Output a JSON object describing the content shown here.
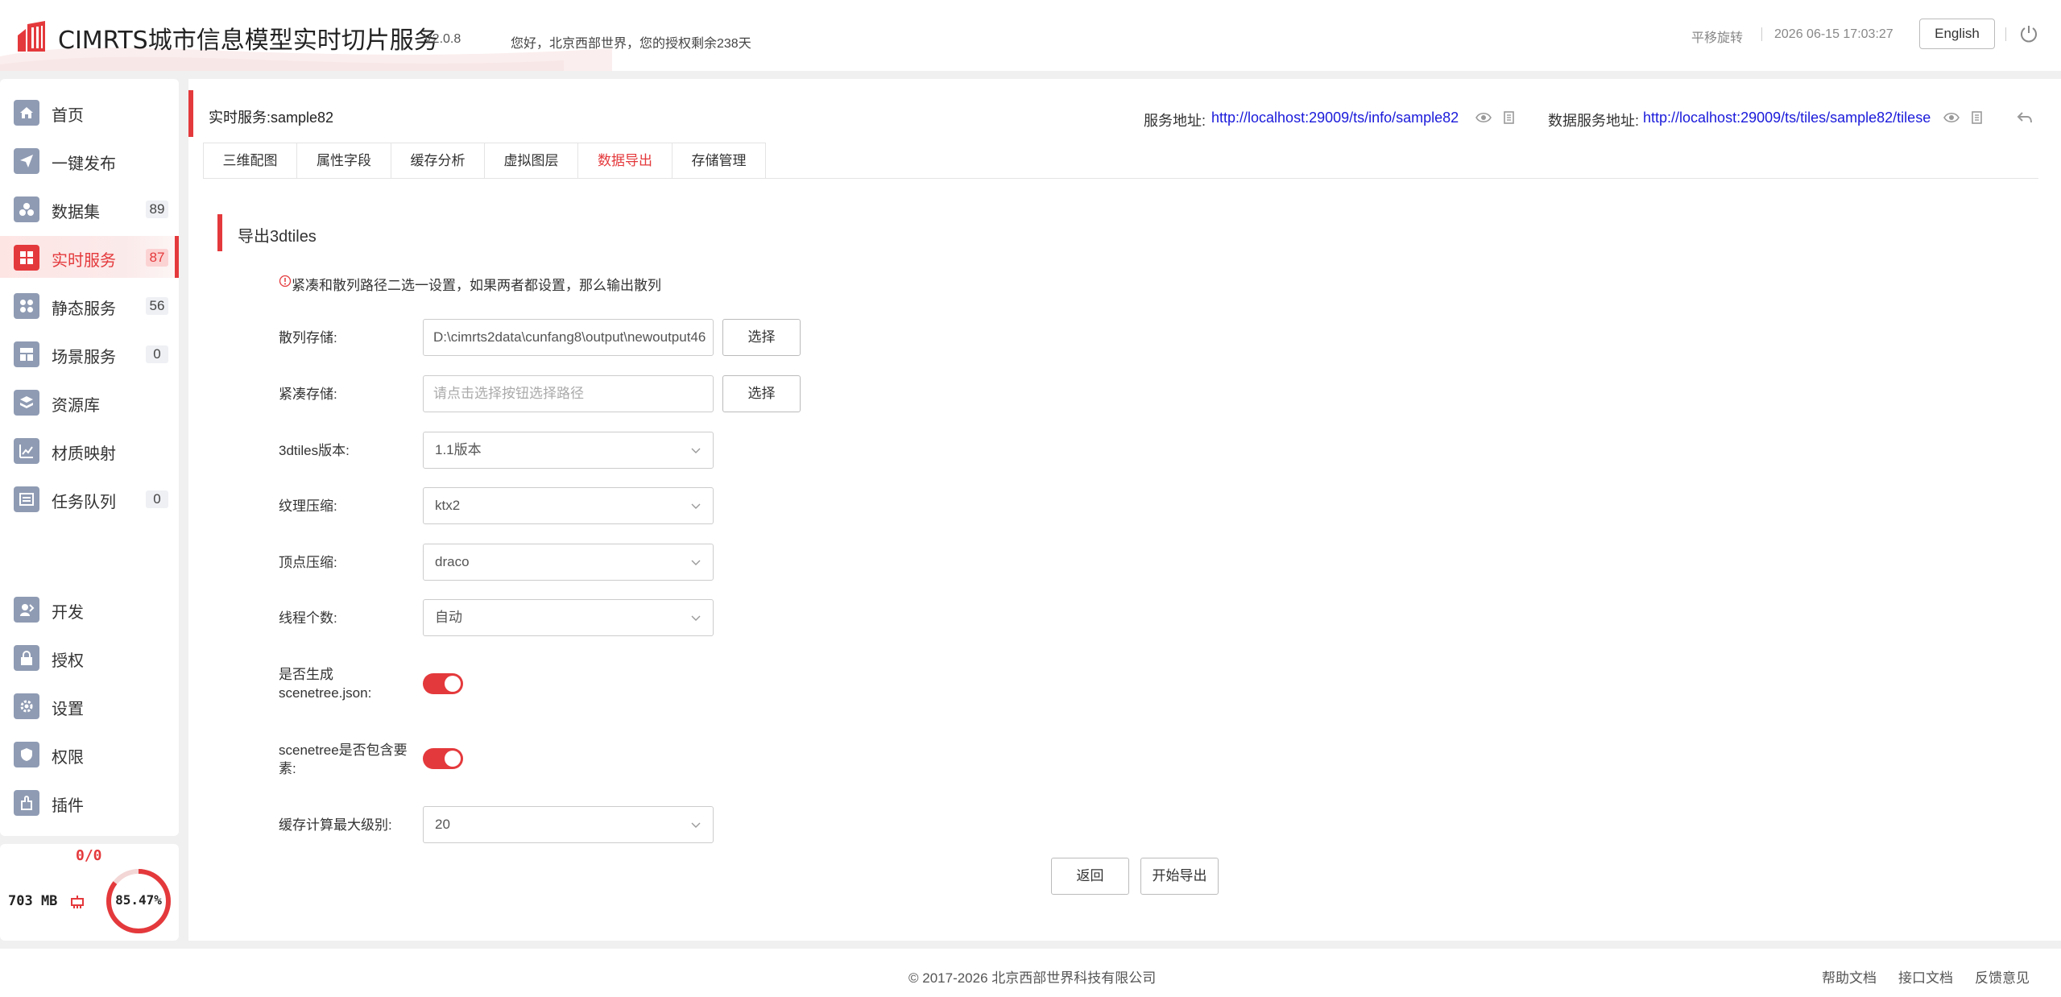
{
  "header": {
    "app_title": "CIMRTS城市信息模型实时切片服务",
    "version": "V2.0.8",
    "greeting": "您好，北京西部世界，您的授权剩余238天",
    "mode": "平移旋转",
    "datetime": "2026 06-15 17:03:27",
    "language_button": "English",
    "logo_icon": "building-logo-icon",
    "power_icon": "power-icon"
  },
  "sidebar": {
    "items": [
      {
        "label": "首页",
        "count": "",
        "icon": "home-icon"
      },
      {
        "label": "一键发布",
        "count": "",
        "icon": "paper-plane-icon"
      },
      {
        "label": "数据集",
        "count": "89",
        "icon": "dataset-icon"
      },
      {
        "label": "实时服务",
        "count": "87",
        "icon": "grid-icon",
        "active": true
      },
      {
        "label": "静态服务",
        "count": "56",
        "icon": "apps-icon"
      },
      {
        "label": "场景服务",
        "count": "0",
        "icon": "scene-icon"
      },
      {
        "label": "资源库",
        "count": "",
        "icon": "layers-icon"
      },
      {
        "label": "材质映射",
        "count": "",
        "icon": "chart-icon"
      },
      {
        "label": "任务队列",
        "count": "0",
        "icon": "queue-icon"
      }
    ],
    "bottom_items": [
      {
        "label": "开发",
        "icon": "developer-icon"
      },
      {
        "label": "授权",
        "icon": "lock-icon"
      },
      {
        "label": "设置",
        "icon": "gear-icon"
      },
      {
        "label": "权限",
        "icon": "shield-icon"
      },
      {
        "label": "插件",
        "icon": "plugin-icon"
      }
    ],
    "status": {
      "tasks": "0/0",
      "memory": "703 MB",
      "usage_text": "85.47%",
      "usage_value": 85.47,
      "accent": "#e4393c"
    }
  },
  "main": {
    "service_title": "实时服务:sample82",
    "service_addr_label": "服务地址:",
    "service_addr": "http://localhost:29009/ts/info/sample82",
    "data_addr_label": "数据服务地址:",
    "data_addr": "http://localhost:29009/ts/tiles/sample82/tilese",
    "tabs": [
      "三维配图",
      "属性字段",
      "缓存分析",
      "虚拟图层",
      "数据导出",
      "存储管理"
    ],
    "active_tab": 4,
    "section_title": "导出3dtiles",
    "tip": "紧凑和散列路径二选一设置，如果两者都设置，那么输出散列",
    "form": {
      "hash_store_label": "散列存储:",
      "hash_store_value": "D:\\cimrts2data\\cunfang8\\output\\newoutput46",
      "compact_store_label": "紧凑存储:",
      "compact_store_placeholder": "请点击选择按钮选择路径",
      "select_button": "选择",
      "version_label": "3dtiles版本:",
      "version_value": "1.1版本",
      "texture_label": "纹理压缩:",
      "texture_value": "ktx2",
      "vertex_label": "顶点压缩:",
      "vertex_value": "draco",
      "threads_label": "线程个数:",
      "threads_value": "自动",
      "scenetree_label": "是否生成scenetree.json:",
      "scenetree_on": true,
      "scenetree_elements_label": "scenetree是否包含要素:",
      "scenetree_elements_on": true,
      "max_level_label": "缓存计算最大级别:",
      "max_level_value": "20"
    },
    "back_button": "返回",
    "export_button": "开始导出"
  },
  "footer": {
    "copyright": "© 2017-2026 北京西部世界科技有限公司",
    "links": [
      "帮助文档",
      "接口文档",
      "反馈意见"
    ]
  }
}
